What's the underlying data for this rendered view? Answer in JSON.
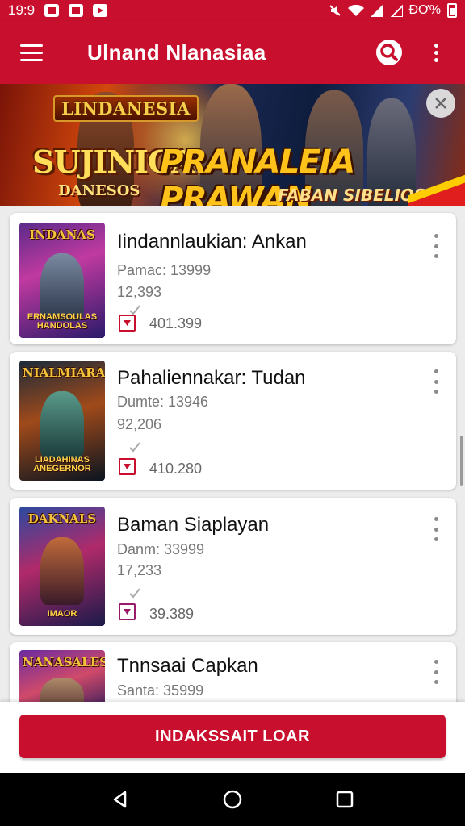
{
  "status_bar": {
    "time": "19:9",
    "battery_text": "ĐƠ%"
  },
  "app_bar": {
    "title": "Ulnand Nlanasiaa"
  },
  "banner": {
    "logo": "LINDANESIA",
    "title_left": "SUJINICA",
    "subtitle_left": "DANESOS",
    "title_right": "PRANALEIA PRAWAN",
    "tagline": "FABAN SIBELIOS!"
  },
  "cards": [
    {
      "title": "Iindannlaukian: Ankan",
      "line1": "Pamac: 13999",
      "line2": "12,393",
      "count": "401.399",
      "thumb_label": "INDANAS",
      "thumb_foot": "ERNAMSOULAS HANDOLAS"
    },
    {
      "title": "Pahaliennakar: Tudan",
      "line1": "Dumte: 13946",
      "line2": "92,206",
      "count": "410.280",
      "thumb_label": "NIALMIARA",
      "thumb_foot": "LIADAHINAS ANEGERNOR"
    },
    {
      "title": "Baman Siaplayan",
      "line1": "Danm: 33999",
      "line2": "17,233",
      "count": "39.389",
      "thumb_label": "DAKNALS",
      "thumb_foot": "IMAOR"
    },
    {
      "title": "Tnnsaai Capkan",
      "line1": "Santa: 35999",
      "line2": "",
      "count": "",
      "thumb_label": "NANASALES",
      "thumb_foot": ""
    }
  ],
  "cta": {
    "label": "INDAKSSAIT LOAR"
  },
  "colors": {
    "primary": "#c8102e",
    "background": "#ececec"
  }
}
